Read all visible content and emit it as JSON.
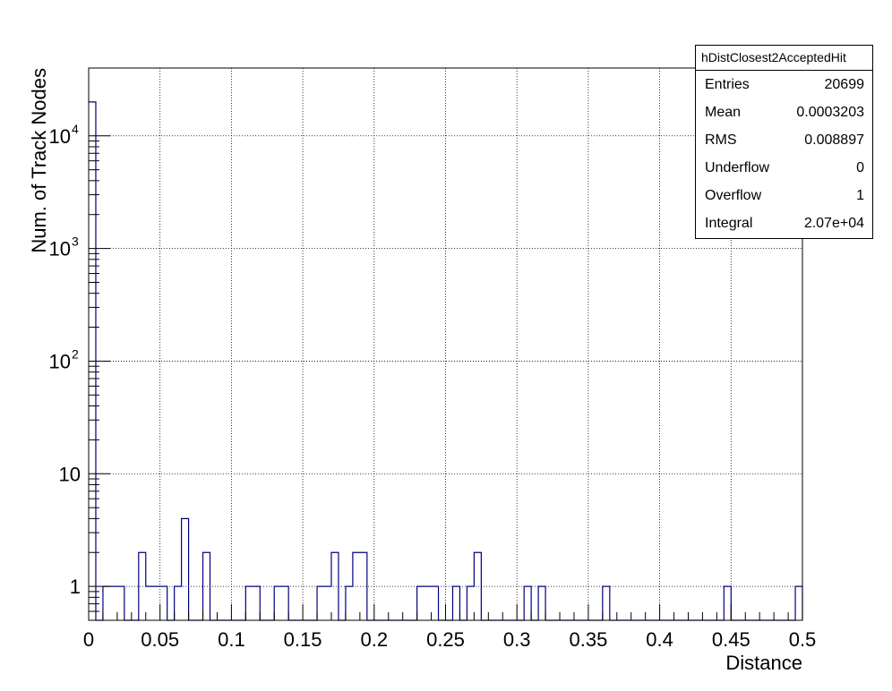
{
  "chart_data": {
    "type": "histogram",
    "xlabel": "Distance",
    "ylabel": "Num. of Track Nodes",
    "xlim": [
      0,
      0.5
    ],
    "ylim": [
      0.5,
      40000
    ],
    "yscale": "log",
    "grid": true,
    "line_color": "#000080",
    "bin_width": 0.005,
    "x_ticks": [
      "0",
      "0.05",
      "0.1",
      "0.15",
      "0.2",
      "0.25",
      "0.3",
      "0.35",
      "0.4",
      "0.45",
      "0.5"
    ],
    "y_ticks": [
      {
        "value": 1,
        "base": "1",
        "exp": ""
      },
      {
        "value": 10,
        "base": "10",
        "exp": ""
      },
      {
        "value": 100,
        "base": "10",
        "exp": "2"
      },
      {
        "value": 1000,
        "base": "10",
        "exp": "3"
      },
      {
        "value": 10000,
        "base": "10",
        "exp": "4"
      }
    ],
    "bins": [
      {
        "x": 0.0,
        "count": 20000
      },
      {
        "x": 0.01,
        "count": 1
      },
      {
        "x": 0.015,
        "count": 1
      },
      {
        "x": 0.02,
        "count": 1
      },
      {
        "x": 0.035,
        "count": 2
      },
      {
        "x": 0.04,
        "count": 1
      },
      {
        "x": 0.045,
        "count": 1
      },
      {
        "x": 0.05,
        "count": 1
      },
      {
        "x": 0.06,
        "count": 1
      },
      {
        "x": 0.065,
        "count": 4
      },
      {
        "x": 0.08,
        "count": 2
      },
      {
        "x": 0.11,
        "count": 1
      },
      {
        "x": 0.115,
        "count": 1
      },
      {
        "x": 0.13,
        "count": 1
      },
      {
        "x": 0.135,
        "count": 1
      },
      {
        "x": 0.16,
        "count": 1
      },
      {
        "x": 0.165,
        "count": 1
      },
      {
        "x": 0.17,
        "count": 2
      },
      {
        "x": 0.18,
        "count": 1
      },
      {
        "x": 0.185,
        "count": 2
      },
      {
        "x": 0.19,
        "count": 2
      },
      {
        "x": 0.23,
        "count": 1
      },
      {
        "x": 0.235,
        "count": 1
      },
      {
        "x": 0.24,
        "count": 1
      },
      {
        "x": 0.255,
        "count": 1
      },
      {
        "x": 0.265,
        "count": 1
      },
      {
        "x": 0.27,
        "count": 2
      },
      {
        "x": 0.305,
        "count": 1
      },
      {
        "x": 0.315,
        "count": 1
      },
      {
        "x": 0.36,
        "count": 1
      },
      {
        "x": 0.445,
        "count": 1
      },
      {
        "x": 0.495,
        "count": 1
      }
    ]
  },
  "stats": {
    "title": "hDistClosest2AcceptedHit",
    "rows": [
      {
        "label": "Entries",
        "value": "20699"
      },
      {
        "label": "Mean",
        "value": "0.0003203"
      },
      {
        "label": "RMS",
        "value": "0.008897"
      },
      {
        "label": "Underflow",
        "value": "0"
      },
      {
        "label": "Overflow",
        "value": "1"
      },
      {
        "label": "Integral",
        "value": "2.07e+04"
      }
    ]
  }
}
